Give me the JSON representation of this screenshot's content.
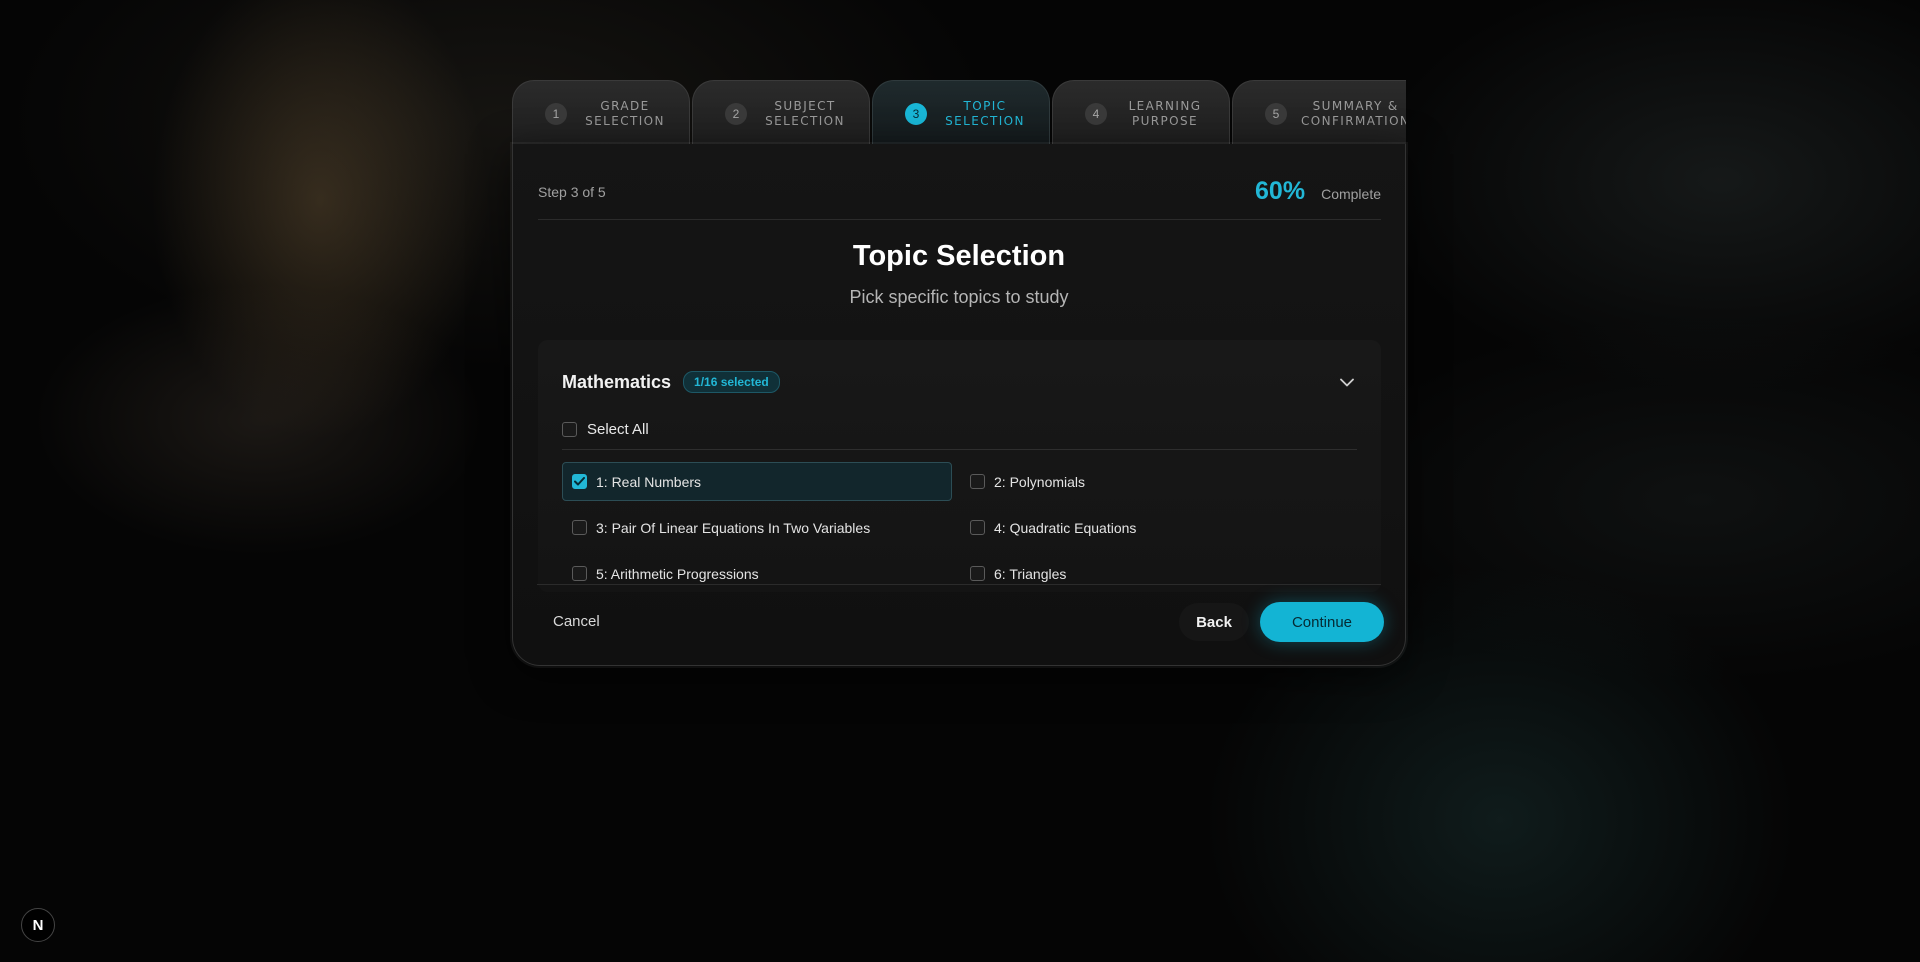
{
  "tabs": [
    {
      "num": "1",
      "label": "GRADE SELECTION"
    },
    {
      "num": "2",
      "label": "SUBJECT SELECTION"
    },
    {
      "num": "3",
      "label": "TOPIC SELECTION"
    },
    {
      "num": "4",
      "label": "LEARNING PURPOSE"
    },
    {
      "num": "5",
      "label": "SUMMARY & CONFIRMATION"
    }
  ],
  "active_tab": 3,
  "header": {
    "step_text": "Step 3 of 5",
    "progress_percent": "60%",
    "progress_label": "Complete"
  },
  "title": "Topic Selection",
  "subtitle": "Pick specific topics to study",
  "section": {
    "name": "Mathematics",
    "badge": "1/16 selected",
    "select_all": "Select All",
    "topics": [
      {
        "label": "1: Real Numbers",
        "checked": true
      },
      {
        "label": "2: Polynomials",
        "checked": false
      },
      {
        "label": "3: Pair Of Linear Equations In Two Variables",
        "checked": false
      },
      {
        "label": "4: Quadratic Equations",
        "checked": false
      },
      {
        "label": "5: Arithmetic Progressions",
        "checked": false
      },
      {
        "label": "6: Triangles",
        "checked": false
      }
    ]
  },
  "footer": {
    "cancel": "Cancel",
    "back": "Back",
    "continue": "Continue"
  },
  "colors": {
    "accent": "#22b7d6",
    "continue_bg": "#13b4d4"
  },
  "corner_badge": "N"
}
